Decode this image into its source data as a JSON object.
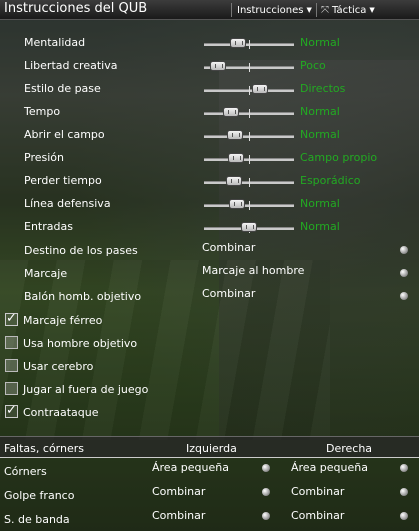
{
  "window": {
    "title": "Instrucciones del QUB"
  },
  "menu": {
    "instrucciones": "Instrucciones",
    "tactica": "Táctica"
  },
  "sliders": [
    {
      "label": "Mentalidad",
      "value": "Normal",
      "level": 0.38
    },
    {
      "label": "Libertad creativa",
      "value": "Poco",
      "level": 0.16
    },
    {
      "label": "Estilo de pase",
      "value": "Directos",
      "level": 0.62
    },
    {
      "label": "Tempo",
      "value": "Normal",
      "level": 0.3
    },
    {
      "label": "Abrir el campo",
      "value": "Normal",
      "level": 0.34
    },
    {
      "label": "Presión",
      "value": "Campo propio",
      "level": 0.36
    },
    {
      "label": "Perder tiempo",
      "value": "Esporádico",
      "level": 0.33
    },
    {
      "label": "Línea defensiva",
      "value": "Normal",
      "level": 0.37
    },
    {
      "label": "Entradas",
      "value": "Normal",
      "level": 0.5
    }
  ],
  "dropdowns": [
    {
      "label": "Destino de los pases",
      "value": "Combinar"
    },
    {
      "label": "Marcaje",
      "value": "Marcaje al hombre"
    },
    {
      "label": "Balón homb. objetivo",
      "value": "Combinar"
    }
  ],
  "checkboxes": [
    {
      "label": "Marcaje férreo",
      "checked": true
    },
    {
      "label": "Usa hombre objetivo",
      "checked": false
    },
    {
      "label": "Usar cerebro",
      "checked": false
    },
    {
      "label": "Jugar al fuera de juego",
      "checked": false
    },
    {
      "label": "Contraataque",
      "checked": true
    }
  ],
  "set_pieces": {
    "header": {
      "col0": "Faltas, córners",
      "col1": "Izquierda",
      "col2": "Derecha"
    },
    "rows": [
      {
        "label": "Córners",
        "left": "Área pequeña",
        "right": "Área pequeña"
      },
      {
        "label": "Golpe franco",
        "left": "Combinar",
        "right": "Combinar"
      },
      {
        "label": "S. de banda",
        "left": "Combinar",
        "right": "Combinar"
      }
    ]
  },
  "check_mark": "✓",
  "colors": {
    "slider_value": "#22aa22",
    "text": "#ffffff"
  }
}
